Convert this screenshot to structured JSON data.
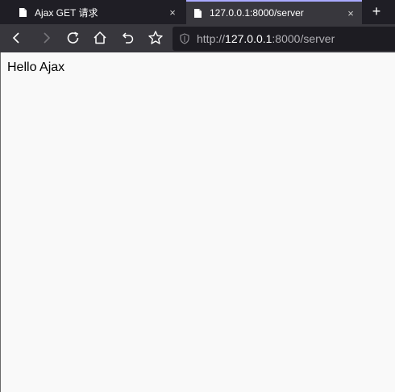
{
  "tabs": [
    {
      "title": "Ajax GET 请求",
      "icon": "document-icon",
      "active": false
    },
    {
      "title": "127.0.0.1:8000/server",
      "icon": "document-icon",
      "active": true
    }
  ],
  "tab_close_glyph": "×",
  "new_tab_glyph": "+",
  "toolbar": {
    "buttons": [
      "back-icon",
      "forward-icon",
      "reload-icon",
      "home-icon",
      "undo-icon",
      "star-icon"
    ]
  },
  "urlbar": {
    "scheme": "http://",
    "host": "127.0.0.1",
    "rest": ":8000/server",
    "icon": "shield-icon"
  },
  "page": {
    "body_text": "Hello Ajax"
  },
  "colors": {
    "tabstrip": "#1f1e25",
    "toolbar": "#38373d",
    "urlbar": "#1d1c22",
    "page_bg": "#f9f9f9"
  }
}
